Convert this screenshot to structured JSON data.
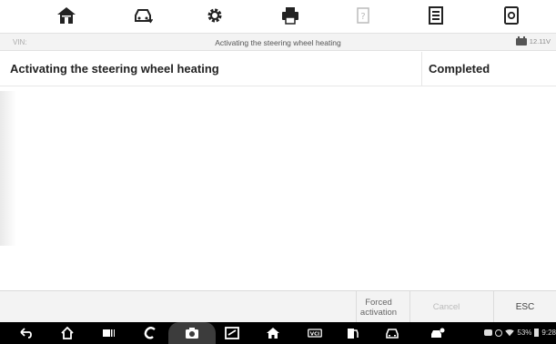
{
  "header": {
    "vin_label": "VIN:",
    "title": "Activating the steering wheel heating",
    "battery_voltage": "12.11V"
  },
  "toolbar": {
    "icons": [
      "home-icon",
      "vehicle-swap-icon",
      "settings-icon",
      "print-icon",
      "help-icon",
      "data-logging-icon",
      "screenshot-icon"
    ]
  },
  "table": {
    "rows": [
      {
        "name": "Activating the steering wheel heating",
        "value": "Completed"
      }
    ]
  },
  "buttons": {
    "forced_activation": "Forced\nactivation",
    "cancel": "Cancel",
    "esc": "ESC"
  },
  "status_bar": {
    "battery_percent": "53%",
    "time": "9:28"
  },
  "colors": {
    "toolbar_icon": "#222222",
    "info_bar": "#f3f3f3",
    "nav_bar": "#000000",
    "disabled_text": "#bbbbbb"
  }
}
